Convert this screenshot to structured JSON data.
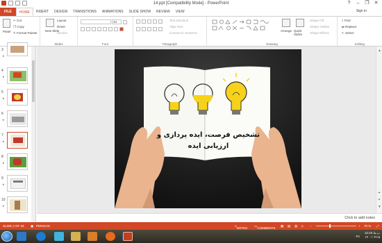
{
  "window": {
    "title": "14.ppt [Compatibility Mode] - PowerPoint",
    "help_btn": "?",
    "minimize": "–",
    "restore": "❐",
    "close": "✕",
    "sign_in": "Sign in"
  },
  "tabs": [
    "FILE",
    "HOME",
    "INSERT",
    "DESIGN",
    "TRANSITIONS",
    "ANIMATIONS",
    "SLIDE SHOW",
    "REVIEW",
    "VIEW"
  ],
  "active_tab": "HOME",
  "ribbon": {
    "clipboard": {
      "label": "Clipboard",
      "paste": "Paste",
      "cut": "Cut",
      "copy": "Copy",
      "format_painter": "Format Painter"
    },
    "slides": {
      "label": "Slides",
      "new_slide": "New Slide",
      "layout": "Layout",
      "reset": "Reset",
      "section": "Section"
    },
    "font": {
      "label": "Font",
      "font_name": "",
      "font_size": "24"
    },
    "paragraph": {
      "label": "Paragraph",
      "text_direction": "Text Direction",
      "align_text": "Align Text",
      "convert_smartart": "Convert to SmartArt"
    },
    "drawing": {
      "label": "Drawing",
      "arrange": "Arrange",
      "quick_styles": "Quick Styles",
      "shape_fill": "Shape Fill",
      "shape_outline": "Shape Outline",
      "shape_effects": "Shape Effects"
    },
    "editing": {
      "label": "Editing",
      "find": "Find",
      "replace": "Replace",
      "select": "Select"
    }
  },
  "thumbnails": [
    {
      "number": "3",
      "star": "★"
    },
    {
      "number": "4",
      "star": "★"
    },
    {
      "number": "5",
      "star": "★"
    },
    {
      "number": "6",
      "star": "★"
    },
    {
      "number": "7",
      "star": "★"
    },
    {
      "number": "8",
      "star": "★"
    },
    {
      "number": "9",
      "star": "★"
    },
    {
      "number": "10",
      "star": "★"
    }
  ],
  "selected_thumbnail": 4,
  "slide": {
    "title_line1": "تشخیص فرصت، ایده پردازی و",
    "title_line2": "ارزیابی ایده"
  },
  "notes_placeholder": "Click to add notes",
  "status": {
    "slide_info": "SLIDE 2 OF 33",
    "language": "PERSIAN",
    "notes": "NOTES",
    "comments": "COMMENTS",
    "zoom": "70 %",
    "zoom_value": 70
  },
  "taskbar": {
    "time": "12:23 ب.ظ",
    "date": "۱۴۰۰/۰۲/۱۵",
    "lang": "FA"
  },
  "colors": {
    "accent": "#d24726",
    "bulb_yellow": "#f7d21a"
  }
}
